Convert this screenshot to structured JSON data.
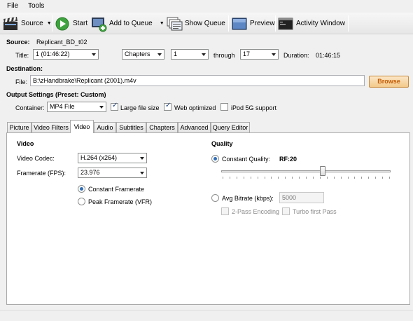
{
  "menu": {
    "file": "File",
    "tools": "Tools"
  },
  "toolbar": {
    "source": "Source",
    "start": "Start",
    "add_to_queue": "Add to Queue",
    "show_queue": "Show Queue",
    "preview": "Preview",
    "activity_window": "Activity Window"
  },
  "source": {
    "label": "Source:",
    "name": "Replicant_BD_t02",
    "title_label": "Title:",
    "title_value": "1 (01:46:22)",
    "range_mode": "Chapters",
    "range_start": "1",
    "through_label": "through",
    "range_end": "17",
    "duration_label": "Duration:",
    "duration_value": "01:46:15"
  },
  "destination": {
    "label": "Destination:",
    "file_label": "File:",
    "file_value": "B:\\zHandbrake\\Replicant (2001).m4v",
    "browse": "Browse"
  },
  "output": {
    "label": "Output Settings (Preset: Custom)",
    "container_label": "Container:",
    "container_value": "MP4 File",
    "large_file_size": "Large file size",
    "large_file_size_checked": true,
    "web_optimized": "Web optimized",
    "web_optimized_checked": true,
    "ipod_5g": "iPod 5G support",
    "ipod_5g_checked": false
  },
  "tabs": [
    {
      "label": "Picture"
    },
    {
      "label": "Video Filters"
    },
    {
      "label": "Video",
      "active": true
    },
    {
      "label": "Audio"
    },
    {
      "label": "Subtitles"
    },
    {
      "label": "Chapters"
    },
    {
      "label": "Advanced"
    },
    {
      "label": "Query Editor"
    }
  ],
  "video": {
    "heading": "Video",
    "codec_label": "Video Codec:",
    "codec_value": "H.264 (x264)",
    "framerate_label": "Framerate (FPS):",
    "framerate_value": "23.976",
    "constant_framerate": "Constant Framerate",
    "constant_selected": true,
    "peak_framerate": "Peak Framerate (VFR)",
    "peak_selected": false
  },
  "quality": {
    "heading": "Quality",
    "constant_quality_label": "Constant Quality:",
    "constant_quality_selected": true,
    "rf_value": "RF:20",
    "slider_fraction": 0.6,
    "avg_bitrate_label": "Avg Bitrate (kbps):",
    "avg_bitrate_selected": false,
    "avg_bitrate_value": "5000",
    "two_pass": "2-Pass Encoding",
    "turbo_first_pass": "Turbo first Pass"
  },
  "colors": {
    "browse_text": "#c45a00",
    "radio_fill": "#2f6db8"
  }
}
